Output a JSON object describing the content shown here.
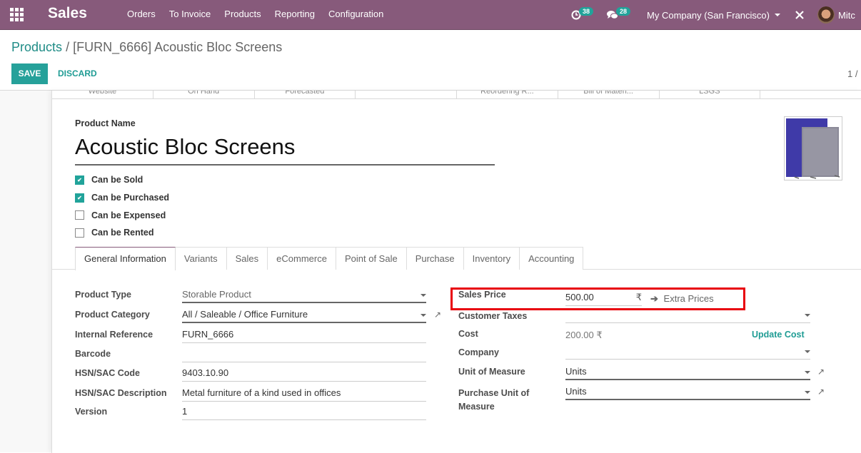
{
  "navbar": {
    "app_name": "Sales",
    "menu": [
      "Orders",
      "To Invoice",
      "Products",
      "Reporting",
      "Configuration"
    ],
    "activity_count": "38",
    "messages_count": "28",
    "company": "My Company (San Francisco)",
    "user_name": "Mitc"
  },
  "control_panel": {
    "breadcrumb_parent": "Products",
    "breadcrumb_sep": "/",
    "breadcrumb_current": "[FURN_6666] Acoustic Bloc Screens",
    "save_label": "SAVE",
    "discard_label": "DISCARD",
    "pager": "1 /"
  },
  "stat_buttons": [
    "Website",
    "On Hand",
    "Forecasted",
    "",
    "Reordering R...",
    "Bill of Materi...",
    "LSGS",
    ""
  ],
  "product": {
    "name_label": "Product Name",
    "name": "Acoustic Bloc Screens",
    "checkboxes": [
      {
        "label": "Can be Sold",
        "checked": true
      },
      {
        "label": "Can be Purchased",
        "checked": true
      },
      {
        "label": "Can be Expensed",
        "checked": false
      },
      {
        "label": "Can be Rented",
        "checked": false
      }
    ]
  },
  "tabs": [
    "General Information",
    "Variants",
    "Sales",
    "eCommerce",
    "Point of Sale",
    "Purchase",
    "Inventory",
    "Accounting"
  ],
  "active_tab": "General Information",
  "left_fields": [
    {
      "label": "Product Type",
      "value": "Storable Product"
    },
    {
      "label": "Product Category",
      "value": "All / Saleable / Office Furniture"
    },
    {
      "label": "Internal Reference",
      "value": "FURN_6666"
    },
    {
      "label": "Barcode",
      "value": ""
    },
    {
      "label": "HSN/SAC Code",
      "value": "9403.10.90"
    },
    {
      "label": "HSN/SAC Description",
      "value": "Metal furniture of a kind used in offices"
    },
    {
      "label": "Version",
      "value": "1"
    }
  ],
  "right_fields": {
    "sales_price_label": "Sales Price",
    "sales_price": "500.00",
    "currency_symbol": "₹",
    "extra_prices_label": "Extra Prices",
    "customer_taxes_label": "Customer Taxes",
    "customer_taxes": "",
    "cost_label": "Cost",
    "cost": "200.00 ₹",
    "update_cost_label": "Update Cost",
    "company_label": "Company",
    "company": "",
    "uom_label": "Unit of Measure",
    "uom": "Units",
    "purchase_uom_label_1": "Purchase Unit of",
    "purchase_uom_label_2": "Measure",
    "purchase_uom": "Units"
  },
  "colors": {
    "brand": "#875A7B",
    "accent": "#21A39A",
    "highlight": "#E8000B"
  }
}
